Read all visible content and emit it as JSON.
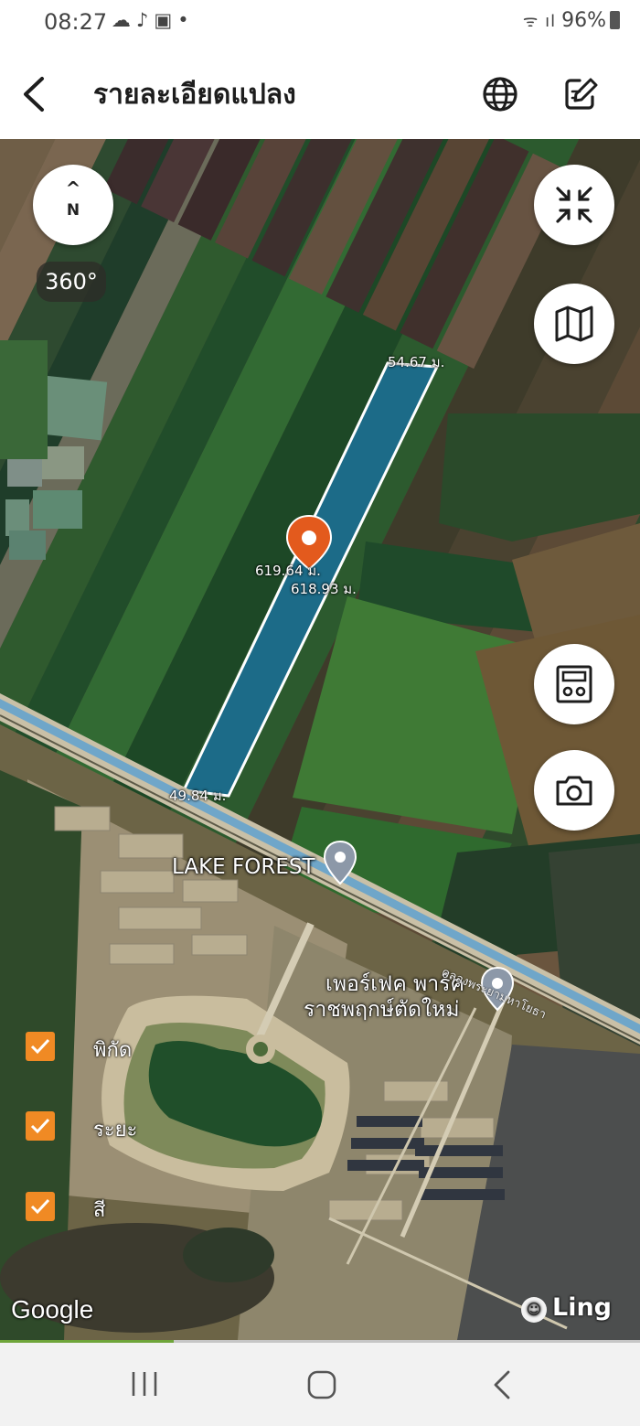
{
  "status_bar": {
    "time": "08:27",
    "icons": [
      "cloud-icon",
      "tiktok-icon",
      "seven-eleven-icon",
      "dot-icon"
    ],
    "battery": "96%"
  },
  "header": {
    "title": "รายละเอียดแปลง",
    "icons": [
      "back-arrow-icon",
      "globe-icon",
      "edit-icon"
    ]
  },
  "map": {
    "compass": {
      "arrow": "^",
      "letter": "N"
    },
    "rotation_label": "360°",
    "distances": {
      "top": "54.67 ม.",
      "left_side": "619.64 ม.",
      "right_side": "618.93 ม.",
      "bottom": "49.84 ม."
    },
    "places": {
      "lake_forest": "LAKE FOREST",
      "perfect_park_line1": "เพอร์เฟค พาร์ค",
      "perfect_park_line2": "ราชพฤกษ์ตัดใหม่",
      "canal": "คลองพระยามหาโยธา"
    },
    "layers": [
      {
        "label": "พิกัด",
        "checked": true
      },
      {
        "label": "ระยะ",
        "checked": true
      },
      {
        "label": "สี",
        "checked": true
      }
    ],
    "attribution": {
      "google": "Google",
      "ling": "Ling"
    },
    "plot_color": "#1a6d95",
    "accent_color": "#f08a24"
  },
  "nav_bar": {
    "icons": [
      "recents-icon",
      "home-icon",
      "back-icon"
    ]
  }
}
